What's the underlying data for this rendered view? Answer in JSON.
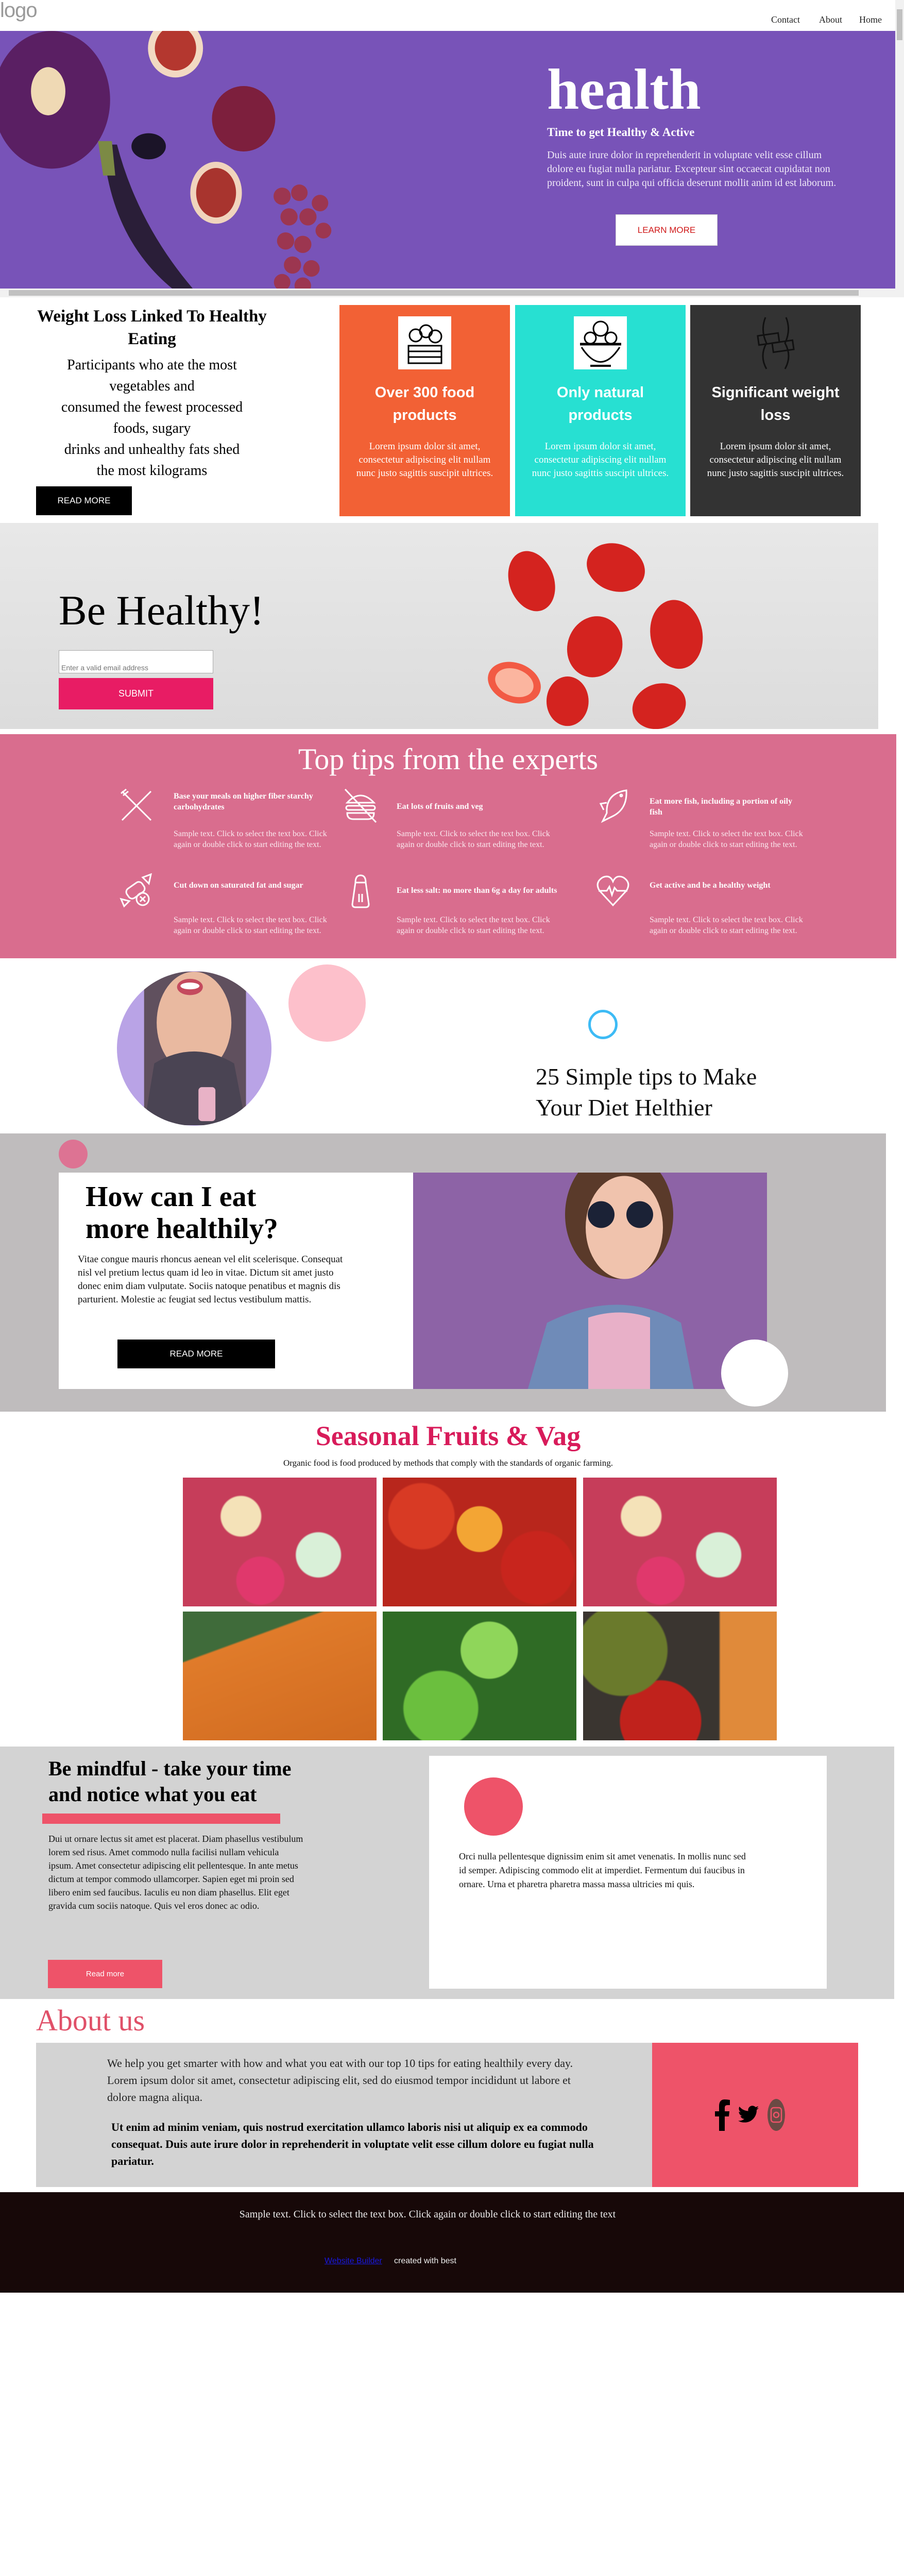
{
  "header": {
    "logo": "logo",
    "nav": [
      "Contact",
      "About",
      "Home"
    ]
  },
  "hero": {
    "title": "health",
    "subtitle": "Time to get Healthy & Active",
    "body": "Duis aute irure dolor in reprehenderit in voluptate velit esse cillum dolore eu fugiat nulla pariatur. Excepteur sint occaecat cupidatat non proident, sunt in culpa qui officia deserunt mollit anim id est laborum.",
    "button": "LEARN MORE",
    "background_color": "#7853b8"
  },
  "weight_loss": {
    "title": "Weight Loss Linked To Healthy Eating",
    "body_lines": [
      "Participants who ate the most",
      "vegetables and",
      "consumed the fewest processed",
      "foods, sugary",
      "drinks and unhealthy fats shed",
      "the most kilograms"
    ],
    "button": "READ MORE",
    "cards": [
      {
        "icon": "vegetable-crate-icon",
        "title": "Over 300 food products",
        "text": "Lorem ipsum dolor sit amet, consectetur adipiscing elit nullam nunc justo sagittis suscipit ultrices.",
        "color": "#f26135"
      },
      {
        "icon": "salad-bowl-icon",
        "title": "Only natural products",
        "text": "Lorem ipsum dolor sit amet, consectetur adipiscing elit nullam nunc justo sagittis suscipit ultrices.",
        "color": "#27e0d2"
      },
      {
        "icon": "waist-measure-icon",
        "title": "Significant weight loss",
        "text": "Lorem ipsum dolor sit amet, consectetur adipiscing elit nullam nunc justo sagittis suscipit ultrices.",
        "color": "#333333"
      }
    ]
  },
  "be_healthy": {
    "title": "Be Healthy!",
    "email_placeholder": "Enter a valid email address",
    "submit": "SUBMIT"
  },
  "tips": {
    "title": "Top tips from the experts",
    "items": [
      {
        "icon": "fork-knife-icon",
        "heading": "Base your meals on higher fiber starchy carbohydrates",
        "text": "Sample text. Click to select the text box. Click again or double click to start editing the text."
      },
      {
        "icon": "no-burger-icon",
        "heading": "Eat lots of fruits and veg",
        "text": "Sample text. Click to select the text box. Click again or double click to start editing the text."
      },
      {
        "icon": "fish-icon",
        "heading": "Eat more fish, including a portion of oily fish",
        "text": "Sample text. Click to select the text box. Click again or double click to start editing the text."
      },
      {
        "icon": "no-candy-icon",
        "heading": "Cut down on saturated fat and sugar",
        "text": "Sample text. Click to select the text box. Click again or double click to start editing the text."
      },
      {
        "icon": "salt-shaker-icon",
        "heading": "Eat less salt: no more than 6g a day for adults",
        "text": "Sample text. Click to select the text box. Click again or double click to start editing the text."
      },
      {
        "icon": "heartbeat-icon",
        "heading": "Get active and be a healthy weight",
        "text": "Sample text. Click to select the text box. Click again or double click to start editing the text."
      }
    ]
  },
  "simple_tips": {
    "title_lines": [
      "25 Simple tips to Make",
      "Your Diet Helthier"
    ]
  },
  "how_eat": {
    "title_lines": [
      "How can I eat",
      "more healthily?"
    ],
    "body": "Vitae congue mauris rhoncus aenean vel elit scelerisque. Consequat nisl vel pretium lectus quam id leo in vitae. Dictum sit amet justo donec enim diam vulputate. Sociis natoque penatibus et magnis dis parturient. Molestie ac feugiat sed lectus vestibulum mattis.",
    "button": "READ MORE"
  },
  "seasonal": {
    "title": "Seasonal Fruits & Vag",
    "subtitle": "Organic food is food produced by methods that comply with the standards of organic farming.",
    "tiles": [
      "apples",
      "nectarines",
      "apples",
      "pumpkins",
      "lettuce",
      "chilies-carrots"
    ]
  },
  "mindful": {
    "title_lines": [
      "Be mindful - take your time",
      "and notice what you eat"
    ],
    "body": "Dui ut ornare lectus sit amet est placerat. Diam phasellus vestibulum lorem sed risus. Amet commodo nulla facilisi nullam vehicula ipsum. Amet consectetur adipiscing elit pellentesque. In ante metus dictum at tempor commodo ullamcorper. Sapien eget mi proin sed libero enim sed faucibus. Iaculis eu non diam phasellus. Elit eget gravida cum sociis natoque. Quis vel eros donec ac odio.",
    "button": "Read more",
    "card_text": "Orci nulla pellentesque dignissim enim sit amet venenatis. In mollis nunc sed id semper. Adipiscing commodo elit at imperdiet. Fermentum dui faucibus in ornare. Urna et pharetra pharetra massa massa ultricies mi quis.",
    "accent": "#ee5369"
  },
  "about": {
    "title": "About us",
    "p1": "We help you get smarter with how and what you eat with our top 10 tips for eating healthily every day. Lorem ipsum dolor sit amet, consectetur adipiscing elit, sed do eiusmod tempor incididunt ut labore et dolore magna aliqua.",
    "p2": "Ut enim ad minim veniam, quis nostrud exercitation ullamco laboris nisi ut aliquip ex ea commodo consequat. Duis aute irure dolor in reprehenderit in voluptate velit esse cillum dolore eu fugiat nulla pariatur.",
    "social": [
      "facebook-icon",
      "twitter-icon",
      "instagram-icon"
    ]
  },
  "footer": {
    "text": "Sample text. Click to select the text box. Click again or double click to start editing the text",
    "link": "Website Builder",
    "created": "created with best"
  }
}
